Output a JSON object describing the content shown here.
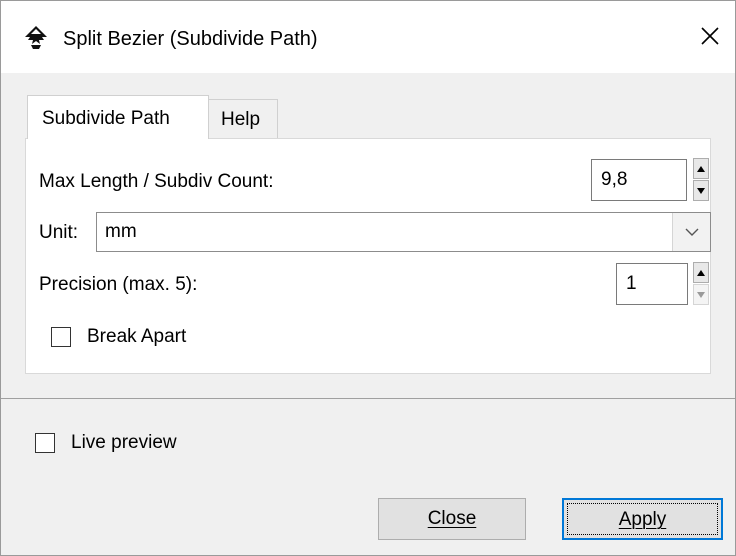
{
  "window": {
    "title": "Split Bezier (Subdivide Path)",
    "app_icon": "inkscape-icon",
    "close_icon": "close-icon"
  },
  "tabs": [
    {
      "label": "Subdivide Path",
      "active": true
    },
    {
      "label": "Help",
      "active": false
    }
  ],
  "form": {
    "max_length_label": "Max Length / Subdiv Count:",
    "max_length_value": "9,8",
    "unit_label": "Unit:",
    "unit_value": "mm",
    "precision_label": "Precision (max. 5):",
    "precision_value": "1",
    "break_apart_label": "Break Apart",
    "break_apart_checked": false
  },
  "footer": {
    "live_preview_label": "Live preview",
    "live_preview_checked": false,
    "close_label": "Close",
    "apply_label": "Apply"
  },
  "colors": {
    "focus_border": "#0078d7",
    "dialog_bg": "#f0f0f0",
    "panel_bg": "#ffffff"
  }
}
